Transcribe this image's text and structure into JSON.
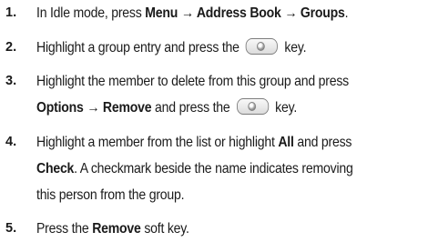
{
  "steps": [
    {
      "number": "1.",
      "t1": "In Idle mode, press ",
      "b1": "Menu → Address Book → Groups",
      "t2": "."
    },
    {
      "number": "2.",
      "t1": "Highlight a group entry and press the",
      "t2": "key."
    },
    {
      "number": "3.",
      "line1": "Highlight the member to delete from this group and press",
      "b1": "Options → Remove",
      "t2": " and press the",
      "t3": "key."
    },
    {
      "number": "4.",
      "t1": "Highlight a member from the list or highlight ",
      "b1": "All",
      "t2": " and press",
      "b2": "Check",
      "t3": ". A checkmark beside the name indicates removing",
      "line3": "this person from the group."
    },
    {
      "number": "5.",
      "t1": "Press the ",
      "b1": "Remove",
      "t2": " soft key."
    }
  ],
  "icons": {
    "key": "center-select-key-icon"
  }
}
